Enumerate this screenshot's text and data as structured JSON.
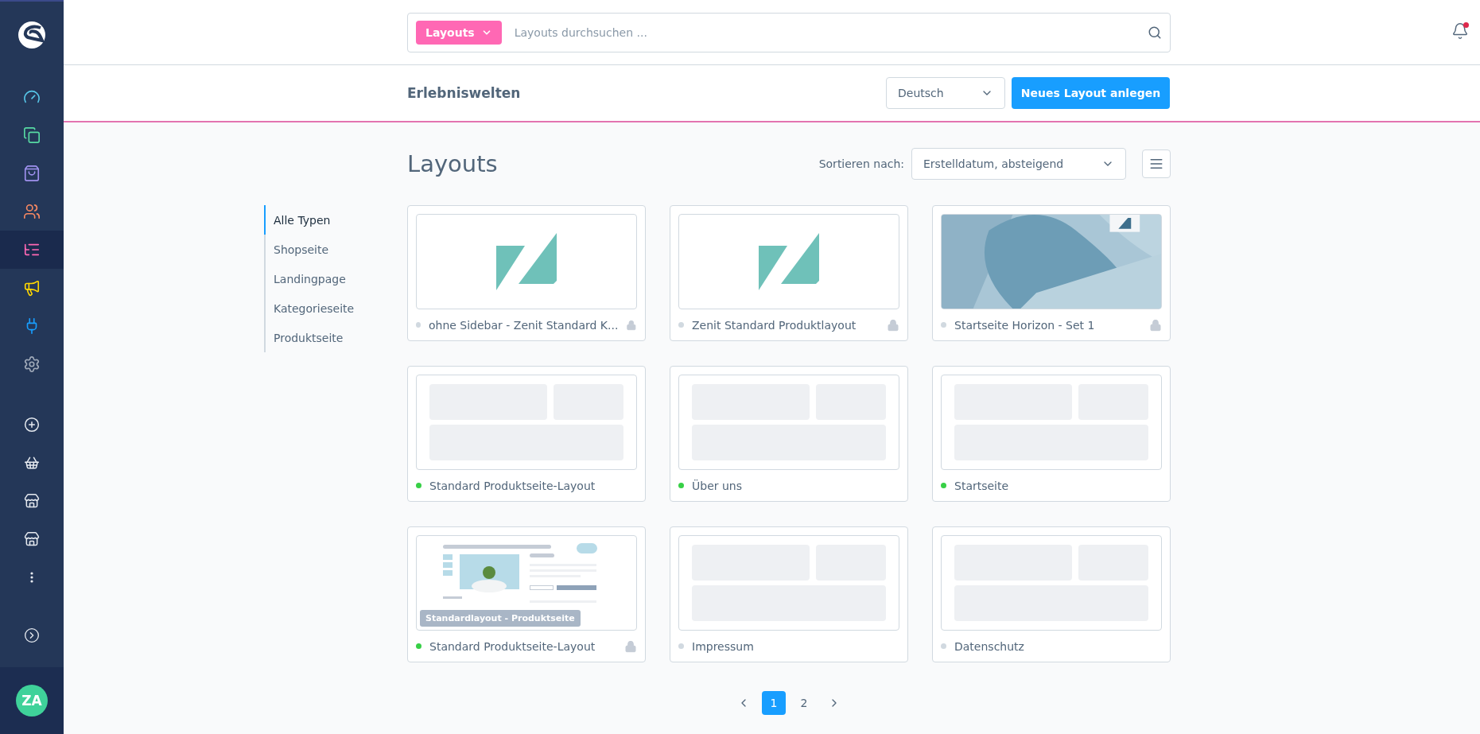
{
  "sidebar": {
    "items": [
      {
        "kind": "dashboard",
        "color": "#57c6e8",
        "selected": false
      },
      {
        "kind": "catalog",
        "color": "#57d9a3",
        "selected": false
      },
      {
        "kind": "orders",
        "color": "#a092f0",
        "selected": false
      },
      {
        "kind": "customers",
        "color": "#f88962",
        "selected": false
      },
      {
        "kind": "content",
        "color": "#ff68b4",
        "selected": true
      },
      {
        "kind": "marketing",
        "color": "#ffd700",
        "selected": false
      },
      {
        "kind": "extensions",
        "color": "#189eff",
        "selected": false
      },
      {
        "kind": "settings",
        "color": "#a1abba",
        "selected": false
      }
    ],
    "extra_items": [
      {
        "kind": "add"
      },
      {
        "kind": "basket"
      },
      {
        "kind": "store"
      },
      {
        "kind": "store"
      },
      {
        "kind": "more"
      }
    ],
    "collapse": {
      "kind": "expand"
    },
    "avatar": {
      "initials": "ZA"
    }
  },
  "search": {
    "filter_label": "Layouts",
    "placeholder": "Layouts durchsuchen ...",
    "notification": true
  },
  "header": {
    "title": "Erlebniswelten",
    "language": "Deutsch",
    "primary_button": "Neues Layout anlegen"
  },
  "main": {
    "heading": "Layouts",
    "sort_label": "Sortieren nach:",
    "sort_value": "Erstelldatum, absteigend"
  },
  "filters": [
    {
      "label": "Alle Typen",
      "selected": true
    },
    {
      "label": "Shopseite",
      "selected": false
    },
    {
      "label": "Landingpage",
      "selected": false
    },
    {
      "label": "Kategorieseite",
      "selected": false
    },
    {
      "label": "Produktseite",
      "selected": false
    }
  ],
  "layouts": [
    {
      "kind": "zenit",
      "name": "ohne Sidebar - Zenit Standard K...",
      "active": false,
      "locked": true
    },
    {
      "kind": "zenit",
      "name": "Zenit Standard Produktlayout",
      "active": false,
      "locked": true
    },
    {
      "kind": "picture",
      "name": "Startseite Horizon - Set 1",
      "active": false,
      "locked": true
    },
    {
      "kind": "blank",
      "name": "Standard Produktseite-Layout",
      "active": true,
      "locked": false
    },
    {
      "kind": "blank",
      "name": "Über uns",
      "active": true,
      "locked": false
    },
    {
      "kind": "blank",
      "name": "Startseite",
      "active": true,
      "locked": false
    },
    {
      "kind": "product",
      "name": "Standard Produktseite-Layout",
      "badge": "Standardlayout - Produktseite",
      "active": true,
      "locked": true
    },
    {
      "kind": "blank",
      "name": "Impressum",
      "active": false,
      "locked": false
    },
    {
      "kind": "blank",
      "name": "Datenschutz",
      "active": false,
      "locked": false
    }
  ],
  "pagination": {
    "pages": [
      {
        "label": "1",
        "selected": true
      },
      {
        "label": "2",
        "selected": false
      }
    ]
  }
}
